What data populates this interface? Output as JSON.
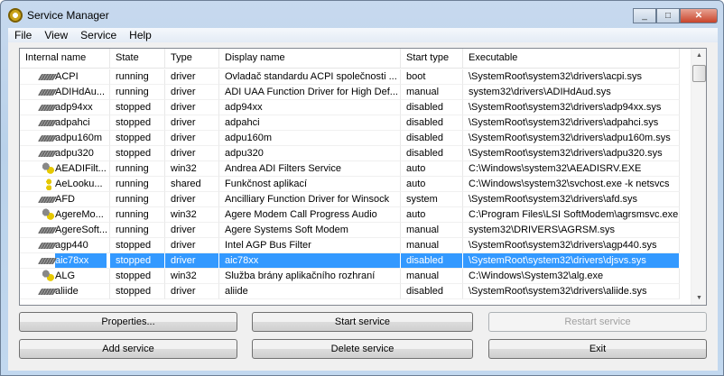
{
  "window": {
    "title": "Service Manager",
    "min": "_",
    "max": "□",
    "close": "✕"
  },
  "menu": [
    "File",
    "View",
    "Service",
    "Help"
  ],
  "columns": [
    "Internal name",
    "State",
    "Type",
    "Display name",
    "Start type",
    "Executable"
  ],
  "rows": [
    [
      "drv",
      "ACPI",
      "running",
      "driver",
      "Ovladač standardu ACPI společnosti ...",
      "boot",
      "\\SystemRoot\\system32\\drivers\\acpi.sys"
    ],
    [
      "drv",
      "ADIHdAu...",
      "running",
      "driver",
      "ADI UAA Function Driver for High Def...",
      "manual",
      "system32\\drivers\\ADIHdAud.sys"
    ],
    [
      "drv",
      "adp94xx",
      "stopped",
      "driver",
      "adp94xx",
      "disabled",
      "\\SystemRoot\\system32\\drivers\\adp94xx.sys"
    ],
    [
      "drv",
      "adpahci",
      "stopped",
      "driver",
      "adpahci",
      "disabled",
      "\\SystemRoot\\system32\\drivers\\adpahci.sys"
    ],
    [
      "drv",
      "adpu160m",
      "stopped",
      "driver",
      "adpu160m",
      "disabled",
      "\\SystemRoot\\system32\\drivers\\adpu160m.sys"
    ],
    [
      "drv",
      "adpu320",
      "stopped",
      "driver",
      "adpu320",
      "disabled",
      "\\SystemRoot\\system32\\drivers\\adpu320.sys"
    ],
    [
      "svc",
      "AEADIFilt...",
      "running",
      "win32",
      "Andrea ADI Filters Service",
      "auto",
      "C:\\Windows\\system32\\AEADISRV.EXE"
    ],
    [
      "shr",
      "AeLooku...",
      "running",
      "shared",
      "Funkčnost aplikací",
      "auto",
      "C:\\Windows\\system32\\svchost.exe -k netsvcs"
    ],
    [
      "drv",
      "AFD",
      "running",
      "driver",
      "Ancilliary Function Driver for Winsock",
      "system",
      "\\SystemRoot\\system32\\drivers\\afd.sys"
    ],
    [
      "svc",
      "AgereMo...",
      "running",
      "win32",
      "Agere Modem Call Progress Audio",
      "auto",
      "C:\\Program Files\\LSI SoftModem\\agrsmsvc.exe"
    ],
    [
      "drv",
      "AgereSoft...",
      "running",
      "driver",
      "Agere Systems Soft Modem",
      "manual",
      "system32\\DRIVERS\\AGRSM.sys"
    ],
    [
      "drv",
      "agp440",
      "stopped",
      "driver",
      "Intel AGP Bus Filter",
      "manual",
      "\\SystemRoot\\system32\\drivers\\agp440.sys"
    ],
    [
      "drv",
      "aic78xx",
      "stopped",
      "driver",
      "aic78xx",
      "disabled",
      "\\SystemRoot\\system32\\drivers\\djsvs.sys"
    ],
    [
      "svc",
      "ALG",
      "stopped",
      "win32",
      "Služba brány aplikačního rozhraní",
      "manual",
      "C:\\Windows\\System32\\alg.exe"
    ],
    [
      "drv",
      "aliide",
      "stopped",
      "driver",
      "aliide",
      "disabled",
      "\\SystemRoot\\system32\\drivers\\aliide.sys"
    ]
  ],
  "selected_row": 12,
  "buttons": {
    "properties": "Properties...",
    "start": "Start service",
    "restart": "Restart service",
    "add": "Add service",
    "delete": "Delete service",
    "exit": "Exit"
  }
}
